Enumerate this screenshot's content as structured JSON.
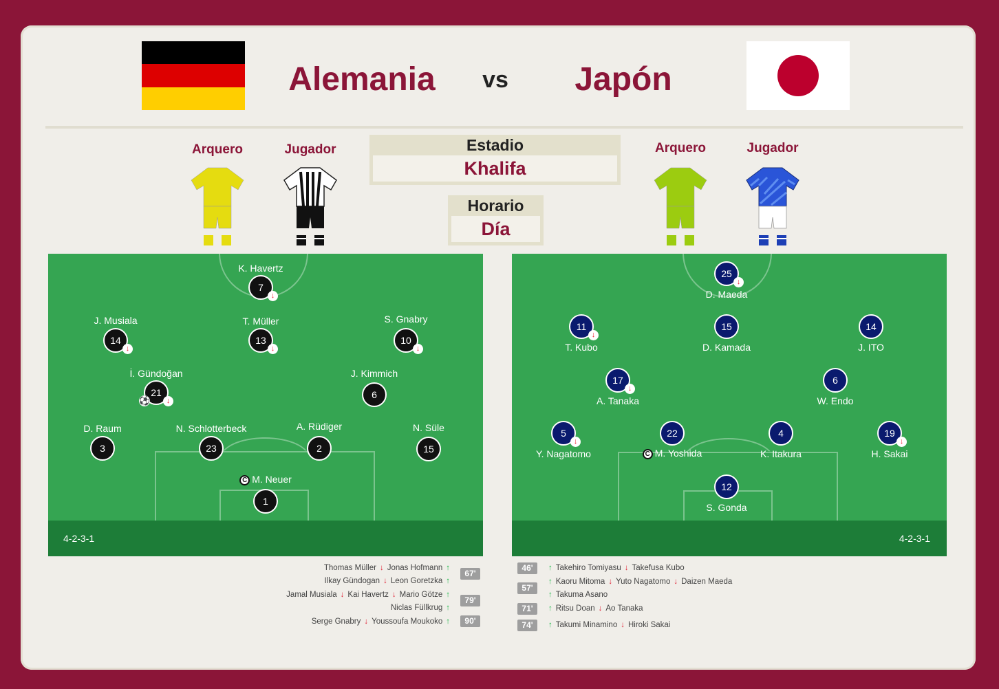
{
  "header": {
    "home_team": "Alemania",
    "away_team": "Japón",
    "vs": "vs"
  },
  "colors": {
    "accent": "#8b1538",
    "pitch": "#35a552",
    "pitch_footer": "#1d7d38",
    "home_player": "#111111",
    "away_player": "#0a1a6e",
    "sub_out": "#e0283a",
    "sub_in": "#1fb84a"
  },
  "kits": {
    "home_gk_label": "Arquero",
    "home_player_label": "Jugador",
    "away_gk_label": "Arquero",
    "away_player_label": "Jugador"
  },
  "info": {
    "stadium_label": "Estadio",
    "stadium_value": "Khalifa",
    "time_label": "Horario",
    "time_value": "Día"
  },
  "home": {
    "formation": "4-2-3-1",
    "players": [
      {
        "name": "K. Havertz",
        "number": "7"
      },
      {
        "name": "J. Musiala",
        "number": "14"
      },
      {
        "name": "T. Müller",
        "number": "13"
      },
      {
        "name": "S. Gnabry",
        "number": "10"
      },
      {
        "name": "İ. Gündoğan",
        "number": "21"
      },
      {
        "name": "J. Kimmich",
        "number": "6"
      },
      {
        "name": "D. Raum",
        "number": "3"
      },
      {
        "name": "N. Schlotterbeck",
        "number": "23"
      },
      {
        "name": "A. Rüdiger",
        "number": "2"
      },
      {
        "name": "N. Süle",
        "number": "15"
      },
      {
        "name": "M. Neuer",
        "number": "1"
      }
    ],
    "subs": [
      {
        "out": "Thomas Müller",
        "in": "Jonas Hofmann",
        "minute": "67'"
      },
      {
        "out": "Ilkay Gündogan",
        "in": "Leon Goretzka",
        "minute": ""
      },
      {
        "out": "Jamal Musiala",
        "in": "Kai Havertz",
        "in2": "Mario Götze",
        "minute": "79'"
      },
      {
        "in": "Niclas Füllkrug"
      },
      {
        "out": "Serge Gnabry",
        "in": "Youssoufa Moukoko",
        "minute": "90'"
      }
    ]
  },
  "away": {
    "formation": "4-2-3-1",
    "players": [
      {
        "name": "D. Maeda",
        "number": "25"
      },
      {
        "name": "T. Kubo",
        "number": "11"
      },
      {
        "name": "D. Kamada",
        "number": "15"
      },
      {
        "name": "J. ITO",
        "number": "14"
      },
      {
        "name": "A. Tanaka",
        "number": "17"
      },
      {
        "name": "W. Endo",
        "number": "6"
      },
      {
        "name": "Y. Nagatomo",
        "number": "5"
      },
      {
        "name": "M. Yoshida",
        "number": "22"
      },
      {
        "name": "K. Itakura",
        "number": "4"
      },
      {
        "name": "H. Sakai",
        "number": "19"
      },
      {
        "name": "S. Gonda",
        "number": "12"
      }
    ],
    "subs": [
      {
        "minute": "46'",
        "in": "Takehiro Tomiyasu",
        "out": "Takefusa Kubo"
      },
      {
        "minute": "57'",
        "in": "Kaoru Mitoma",
        "out": "Yuto Nagatomo",
        "out2": "Daizen Maeda"
      },
      {
        "in": "Takuma Asano"
      },
      {
        "minute": "71'",
        "in": "Ritsu Doan",
        "out": "Ao Tanaka"
      },
      {
        "minute": "74'",
        "in": "Takumi Minamino",
        "out": "Hiroki Sakai"
      }
    ]
  }
}
